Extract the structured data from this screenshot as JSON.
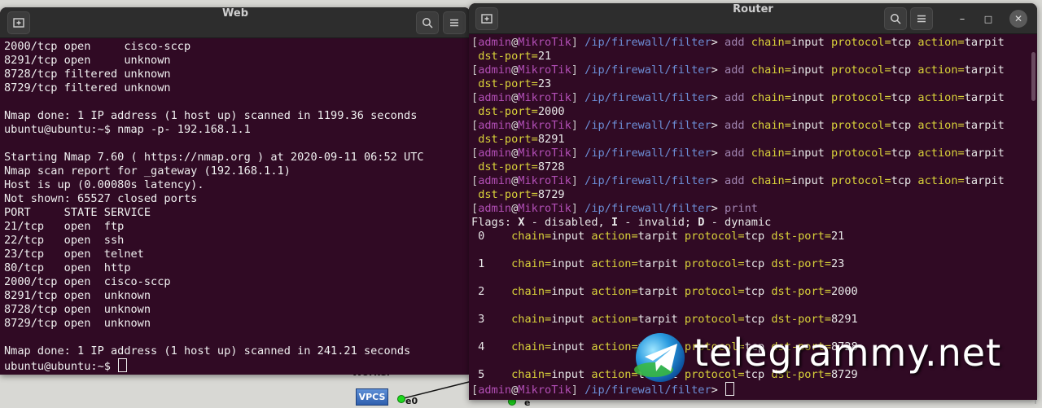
{
  "desktop": {
    "worker_label": "Worker",
    "vpcs_label": "VPCS",
    "port_label_left": "e0",
    "port_label_right": "e"
  },
  "web_window": {
    "title": "Web",
    "icons": {
      "new_tab": "new-tab-icon",
      "search": "search-icon",
      "menu": "hamburger-menu-icon"
    },
    "lines": [
      "2000/tcp open     cisco-sccp",
      "8291/tcp open     unknown",
      "8728/tcp filtered unknown",
      "8729/tcp filtered unknown",
      "",
      "Nmap done: 1 IP address (1 host up) scanned in 1199.36 seconds",
      "ubuntu@ubuntu:~$ nmap -p- 192.168.1.1",
      "",
      "Starting Nmap 7.60 ( https://nmap.org ) at 2020-09-11 06:52 UTC",
      "Nmap scan report for _gateway (192.168.1.1)",
      "Host is up (0.00080s latency).",
      "Not shown: 65527 closed ports",
      "PORT     STATE SERVICE",
      "21/tcp   open  ftp",
      "22/tcp   open  ssh",
      "23/tcp   open  telnet",
      "80/tcp   open  http",
      "2000/tcp open  cisco-sccp",
      "8291/tcp open  unknown",
      "8728/tcp open  unknown",
      "8729/tcp open  unknown",
      "",
      "Nmap done: 1 IP address (1 host up) scanned in 241.21 seconds"
    ],
    "final_prompt": "ubuntu@ubuntu:~$ "
  },
  "router_window": {
    "title": "Router",
    "icons": {
      "new_tab": "new-tab-icon",
      "search": "search-icon",
      "menu": "hamburger-menu-icon",
      "minimize": "minimize-icon",
      "maximize": "maximize-icon",
      "close": "close-icon"
    },
    "minimize_glyph": "–",
    "maximize_glyph": "□",
    "close_glyph": "✕",
    "prompt": {
      "open": "[",
      "user": "admin",
      "at": "@",
      "host": "MikroTik",
      "close": "]",
      "path": " /ip/firewall/filter",
      "gt": "> "
    },
    "add_commands": [
      {
        "cmd": "add",
        "chain_key": "chain=",
        "chain_val": "input",
        "proto_key": "protocol=",
        "proto_val": "tcp",
        "action_key": "action=",
        "action_val": "tarpit",
        "port_key": "dst-port=",
        "port_val": "21"
      },
      {
        "cmd": "add",
        "chain_key": "chain=",
        "chain_val": "input",
        "proto_key": "protocol=",
        "proto_val": "tcp",
        "action_key": "action=",
        "action_val": "tarpit",
        "port_key": "dst-port=",
        "port_val": "23"
      },
      {
        "cmd": "add",
        "chain_key": "chain=",
        "chain_val": "input",
        "proto_key": "protocol=",
        "proto_val": "tcp",
        "action_key": "action=",
        "action_val": "tarpit",
        "port_key": "dst-port=",
        "port_val": "2000"
      },
      {
        "cmd": "add",
        "chain_key": "chain=",
        "chain_val": "input",
        "proto_key": "protocol=",
        "proto_val": "tcp",
        "action_key": "action=",
        "action_val": "tarpit",
        "port_key": "dst-port=",
        "port_val": "8291"
      },
      {
        "cmd": "add",
        "chain_key": "chain=",
        "chain_val": "input",
        "proto_key": "protocol=",
        "proto_val": "tcp",
        "action_key": "action=",
        "action_val": "tarpit",
        "port_key": "dst-port=",
        "port_val": "8728"
      },
      {
        "cmd": "add",
        "chain_key": "chain=",
        "chain_val": "input",
        "proto_key": "protocol=",
        "proto_val": "tcp",
        "action_key": "action=",
        "action_val": "tarpit",
        "port_key": "dst-port=",
        "port_val": "8729"
      }
    ],
    "print_cmd": "print",
    "flags": {
      "prefix": "Flags: ",
      "x": "X",
      "x_desc": " - disabled, ",
      "i": "I",
      "i_desc": " - invalid; ",
      "d": "D",
      "d_desc": " - dynamic"
    },
    "rules": [
      {
        "idx": " 0",
        "chain_key": "chain=",
        "chain_val": "input",
        "action_key": " action=",
        "action_val": "tarpit",
        "proto_key": " protocol=",
        "proto_val": "tcp",
        "port_key": " dst-port=",
        "port_val": "21"
      },
      {
        "idx": " 1",
        "chain_key": "chain=",
        "chain_val": "input",
        "action_key": " action=",
        "action_val": "tarpit",
        "proto_key": " protocol=",
        "proto_val": "tcp",
        "port_key": " dst-port=",
        "port_val": "23"
      },
      {
        "idx": " 2",
        "chain_key": "chain=",
        "chain_val": "input",
        "action_key": " action=",
        "action_val": "tarpit",
        "proto_key": " protocol=",
        "proto_val": "tcp",
        "port_key": " dst-port=",
        "port_val": "2000"
      },
      {
        "idx": " 3",
        "chain_key": "chain=",
        "chain_val": "input",
        "action_key": " action=",
        "action_val": "tarpit",
        "proto_key": " protocol=",
        "proto_val": "tcp",
        "port_key": " dst-port=",
        "port_val": "8291"
      },
      {
        "idx": " 4",
        "chain_key": "chain=",
        "chain_val": "input",
        "action_key": " action=",
        "action_val": "tarpit",
        "proto_key": " protocol=",
        "proto_val": "tcp",
        "port_key": " dst-port=",
        "port_val": "8728"
      },
      {
        "idx": " 5",
        "chain_key": "chain=",
        "chain_val": "input",
        "action_key": " action=",
        "action_val": "tarpit",
        "proto_key": " protocol=",
        "proto_val": "tcp",
        "port_key": " dst-port=",
        "port_val": "8729"
      }
    ]
  },
  "watermark": {
    "text": "telegrammy.net",
    "icon": "telegram-logo-icon"
  }
}
